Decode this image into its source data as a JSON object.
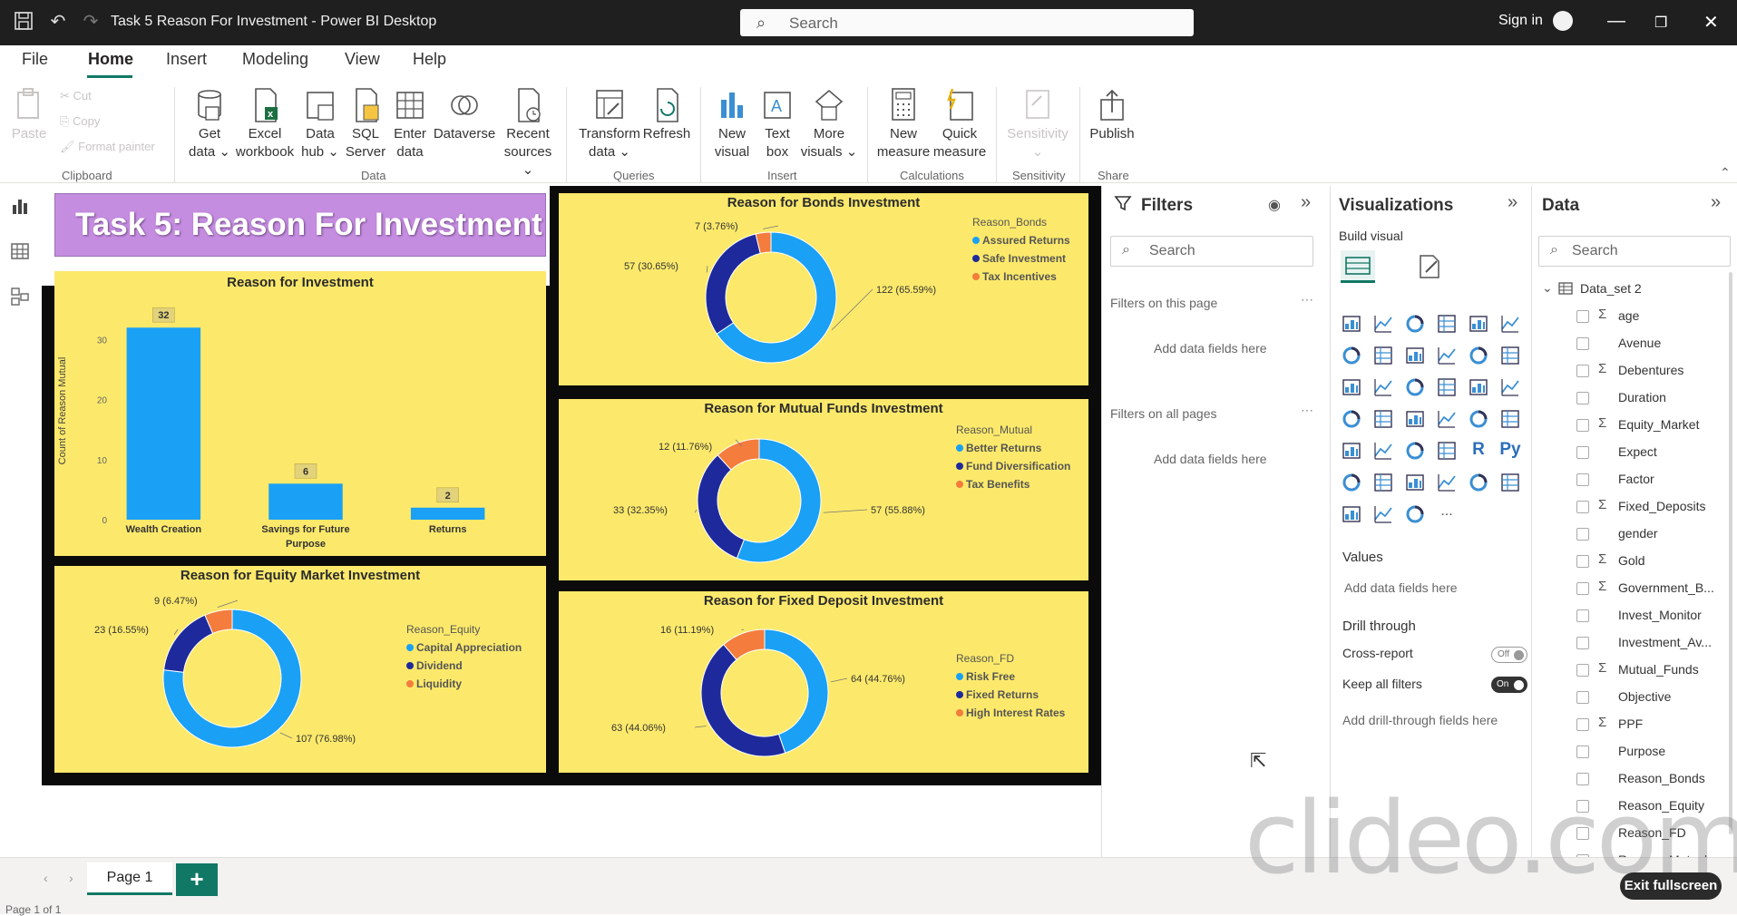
{
  "window": {
    "title": "Task 5 Reason For Investment - Power BI Desktop",
    "search_placeholder": "Search",
    "signin": "Sign in"
  },
  "menu": {
    "tabs": [
      "File",
      "Home",
      "Insert",
      "Modeling",
      "View",
      "Help"
    ],
    "active": "Home"
  },
  "ribbon": {
    "clipboard": {
      "paste": "Paste",
      "cut": "Cut",
      "copy": "Copy",
      "format_painter": "Format painter",
      "label": "Clipboard"
    },
    "data": {
      "get_data": [
        "Get",
        "data ⌄"
      ],
      "excel": [
        "Excel",
        "workbook"
      ],
      "data_hub": [
        "Data",
        "hub ⌄"
      ],
      "sql": [
        "SQL",
        "Server"
      ],
      "enter": [
        "Enter",
        "data"
      ],
      "dataverse": [
        "Dataverse",
        ""
      ],
      "recent": [
        "Recent",
        "sources ⌄"
      ],
      "label": "Data"
    },
    "queries": {
      "transform": [
        "Transform",
        "data ⌄"
      ],
      "refresh": [
        "Refresh",
        ""
      ],
      "label": "Queries"
    },
    "insert": {
      "new_visual": [
        "New",
        "visual"
      ],
      "text_box": [
        "Text",
        "box"
      ],
      "more_visuals": [
        "More",
        "visuals ⌄"
      ],
      "label": "Insert"
    },
    "calculations": {
      "new_measure": [
        "New",
        "measure"
      ],
      "quick_measure": [
        "Quick",
        "measure"
      ],
      "label": "Calculations"
    },
    "sensitivity": {
      "btn": [
        "Sensitivity",
        "⌄"
      ],
      "label": "Sensitivity"
    },
    "share": {
      "publish": [
        "Publish",
        ""
      ],
      "label": "Share"
    }
  },
  "report": {
    "banner": "Task 5: Reason For Investment",
    "bar_chart": {
      "title": "Reason for Investment",
      "ylabel": "Count of Reason Mutual"
    },
    "bonds": {
      "title": "Reason for Bonds Investment",
      "legend_title": "Reason_Bonds"
    },
    "mutual": {
      "title": "Reason for Mutual Funds Investment",
      "legend_title": "Reason_Mutual"
    },
    "equity": {
      "title": "Reason for Equity Market Investment",
      "legend_title": "Reason_Equity"
    },
    "fd": {
      "title": "Reason for Fixed Deposit Investment",
      "legend_title": "Reason_FD"
    }
  },
  "chart_data": [
    {
      "type": "bar",
      "title": "Reason for Investment",
      "ylabel": "Count of Reason Mutual",
      "categories": [
        "Wealth Creation",
        "Savings for Future Purpose",
        "Returns"
      ],
      "category_lines": [
        [
          "Wealth Creation"
        ],
        [
          "Savings for Future",
          "Purpose"
        ],
        [
          "Returns"
        ]
      ],
      "values": [
        32,
        6,
        2
      ],
      "ylim": [
        0,
        34
      ],
      "yticks": [
        0,
        10,
        20,
        30
      ],
      "color": "#1aa0f5"
    },
    {
      "type": "pie",
      "title": "Reason for Bonds Investment",
      "legend_title": "Reason_Bonds",
      "labels": [
        "Assured Returns",
        "Safe Investment",
        "Tax Incentives"
      ],
      "values": [
        122,
        57,
        7
      ],
      "data_labels": [
        "122 (65.59%)",
        "57 (30.65%)",
        "7 (3.76%)"
      ],
      "colors": [
        "#1aa0f5",
        "#1e2a9c",
        "#f47c3c"
      ]
    },
    {
      "type": "pie",
      "title": "Reason for Mutual Funds Investment",
      "legend_title": "Reason_Mutual",
      "labels": [
        "Better Returns",
        "Fund Diversification",
        "Tax Benefits"
      ],
      "values": [
        57,
        33,
        12
      ],
      "data_labels": [
        "57 (55.88%)",
        "33 (32.35%)",
        "12 (11.76%)"
      ],
      "colors": [
        "#1aa0f5",
        "#1e2a9c",
        "#f47c3c"
      ]
    },
    {
      "type": "pie",
      "title": "Reason for Equity Market Investment",
      "legend_title": "Reason_Equity",
      "labels": [
        "Capital Appreciation",
        "Dividend",
        "Liquidity"
      ],
      "values": [
        107,
        23,
        9
      ],
      "data_labels": [
        "107 (76.98%)",
        "23 (16.55%)",
        "9 (6.47%)"
      ],
      "colors": [
        "#1aa0f5",
        "#1e2a9c",
        "#f47c3c"
      ]
    },
    {
      "type": "pie",
      "title": "Reason for Fixed Deposit Investment",
      "legend_title": "Reason_FD",
      "labels": [
        "Risk Free",
        "Fixed Returns",
        "High Interest Rates"
      ],
      "values": [
        64,
        63,
        16
      ],
      "data_labels": [
        "64 (44.76%)",
        "63 (44.06%)",
        "16 (11.19%)"
      ],
      "colors": [
        "#1aa0f5",
        "#1e2a9c",
        "#f47c3c"
      ]
    }
  ],
  "filters": {
    "title": "Filters",
    "search": "Search",
    "this_page": "Filters on this page",
    "all_pages": "Filters on all pages",
    "add_fields": "Add data fields here"
  },
  "visualizations": {
    "title": "Visualizations",
    "build_visual": "Build visual",
    "values": "Values",
    "add_fields": "Add data fields here",
    "drill_through": "Drill through",
    "cross_report": "Cross-report",
    "cross_report_state": "Off",
    "keep_all_filters": "Keep all filters",
    "keep_all_filters_state": "On",
    "add_drill": "Add drill-through fields here",
    "r_label": "R",
    "py_label": "Py",
    "more": "..."
  },
  "data_pane": {
    "title": "Data",
    "search": "Search",
    "table": "Data_set 2",
    "fields": [
      {
        "name": "age",
        "sigma": true
      },
      {
        "name": "Avenue",
        "sigma": false
      },
      {
        "name": "Debentures",
        "sigma": true
      },
      {
        "name": "Duration",
        "sigma": false
      },
      {
        "name": "Equity_Market",
        "sigma": true
      },
      {
        "name": "Expect",
        "sigma": false
      },
      {
        "name": "Factor",
        "sigma": false
      },
      {
        "name": "Fixed_Deposits",
        "sigma": true
      },
      {
        "name": "gender",
        "sigma": false
      },
      {
        "name": "Gold",
        "sigma": true
      },
      {
        "name": "Government_B...",
        "sigma": true
      },
      {
        "name": "Invest_Monitor",
        "sigma": false
      },
      {
        "name": "Investment_Av...",
        "sigma": false
      },
      {
        "name": "Mutual_Funds",
        "sigma": true
      },
      {
        "name": "Objective",
        "sigma": false
      },
      {
        "name": "PPF",
        "sigma": true
      },
      {
        "name": "Purpose",
        "sigma": false
      },
      {
        "name": "Reason_Bonds",
        "sigma": false
      },
      {
        "name": "Reason_Equity",
        "sigma": false
      },
      {
        "name": "Reason_FD",
        "sigma": false
      },
      {
        "name": "Reason_Mutual",
        "sigma": false
      }
    ]
  },
  "bottom": {
    "page_tab": "Page 1",
    "add_page": "+",
    "exit_fullscreen": "Exit fullscreen",
    "watermark": "clideo.com",
    "page_count": "Page 1 of 1"
  }
}
